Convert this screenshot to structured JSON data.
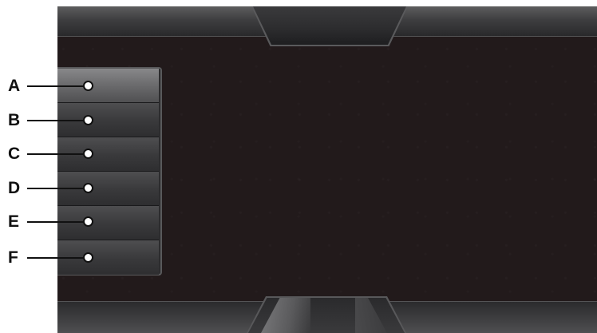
{
  "colors": {
    "screen_background": "#221a1b",
    "bar": "#3e3e40",
    "button": "#39393b",
    "button_highlighted": "#6d6d6f",
    "callout": "#111111"
  },
  "panel": {
    "buttons": [
      {
        "callout": "A",
        "highlighted": true
      },
      {
        "callout": "B",
        "highlighted": false
      },
      {
        "callout": "C",
        "highlighted": false
      },
      {
        "callout": "D",
        "highlighted": false
      },
      {
        "callout": "E",
        "highlighted": false
      },
      {
        "callout": "F",
        "highlighted": false
      }
    ]
  },
  "callouts": {
    "a": "A",
    "b": "B",
    "c": "C",
    "d": "D",
    "e": "E",
    "f": "F"
  }
}
